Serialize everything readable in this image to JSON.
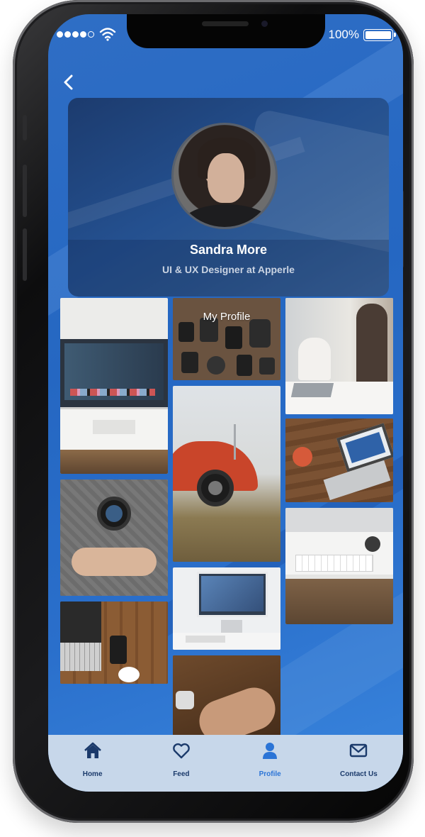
{
  "status_bar": {
    "signal_bars": 5,
    "signal_active": 4,
    "battery_text": "100%",
    "battery_level": 1.0
  },
  "header": {
    "back_icon": "chevron-left-icon"
  },
  "profile": {
    "name": "Sandra More",
    "role": "UI & UX Designer at Apperle"
  },
  "gallery": {
    "title": "My Profile",
    "photos": [
      "tv-stand-photo",
      "camera-gear-photo",
      "woman-laptop-photo",
      "red-car-photo",
      "laptop-desk-photo",
      "camera-hands-photo",
      "keyboard-imac-photo",
      "imac-desk-photo",
      "laptop-phone-coffee-photo",
      "hands-watch-photo"
    ]
  },
  "tabbar": {
    "tabs": [
      {
        "label": "Home",
        "icon": "home-icon",
        "active": false
      },
      {
        "label": "Feed",
        "icon": "heart-icon",
        "active": false
      },
      {
        "label": "Profile",
        "icon": "user-icon",
        "active": true
      },
      {
        "label": "Contact Us",
        "icon": "envelope-icon",
        "active": false
      }
    ]
  },
  "colors": {
    "screen_bg": "#2567c2",
    "tabbar_bg": "#c7d7ea",
    "tab_active": "#2b74d6",
    "tab_inactive": "#1b3a6b"
  }
}
